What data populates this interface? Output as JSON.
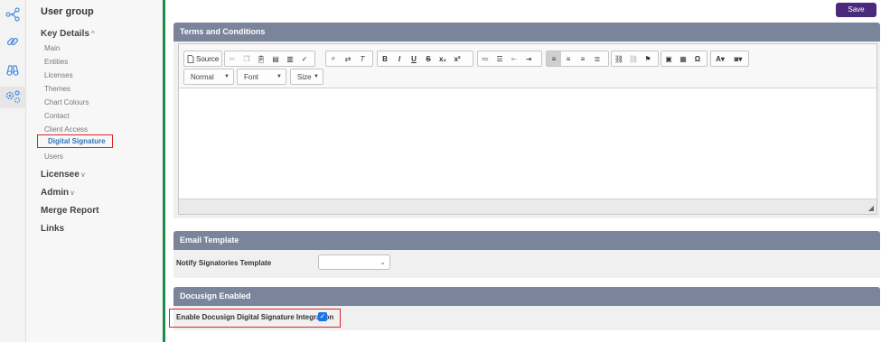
{
  "rail": {
    "icons": [
      "network-icon",
      "link-icon",
      "binoculars-icon",
      "settings-network-icon"
    ]
  },
  "sidebar": {
    "title": "User group",
    "key_details": {
      "label": "Key Details",
      "chevron": "^"
    },
    "items": [
      "Main",
      "Entities",
      "Licenses",
      "Themes",
      "Chart Colours",
      "Contact",
      "Client Access",
      "Digital Signature",
      "Users"
    ],
    "selected_index": 7,
    "licensee": {
      "label": "Licensee",
      "chevron": "v"
    },
    "admin": {
      "label": "Admin",
      "chevron": "v"
    },
    "merge_report": "Merge Report",
    "links": "Links"
  },
  "header": {
    "save_label": "Save"
  },
  "terms": {
    "title": "Terms and Conditions",
    "toolbar": {
      "source_label": "Source",
      "format_combo": "Normal",
      "font_combo": "Font",
      "size_combo": "Size"
    }
  },
  "email": {
    "title": "Email Template",
    "notify_label": "Notify Signatories Template",
    "notify_value": ""
  },
  "docusign": {
    "title": "Docusign Enabled",
    "enable_label": "Enable Docusign Digital Signature Integration",
    "enabled": true
  },
  "colors": {
    "accent": "#4b2a7b",
    "panel_header": "#7a849b",
    "sidebar_border": "#1e8a4c",
    "highlight": "#d9262c",
    "checkbox": "#1a73e8"
  }
}
